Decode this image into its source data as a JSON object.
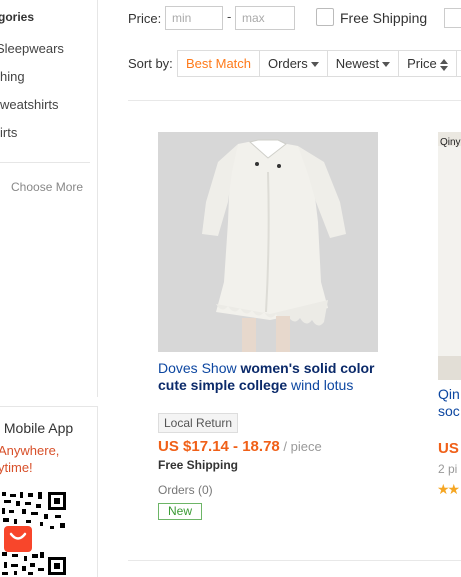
{
  "sidebar": {
    "categories_title": "gories",
    "items": [
      "Sleepwears",
      "hing",
      "weatshirts",
      "irts"
    ],
    "choose_more": "Choose More"
  },
  "app_promo": {
    "title": "s Mobile App",
    "line1": "Anywhere,",
    "line2": "ytime!",
    "badge_text": "AliExpress"
  },
  "filters": {
    "price_label": "Price:",
    "min_placeholder": "min",
    "max_placeholder": "max",
    "dash": "-",
    "free_shipping_label": "Free Shipping"
  },
  "sort": {
    "label": "Sort by:",
    "options": [
      "Best Match",
      "Orders",
      "Newest",
      "Price"
    ],
    "active_index": 0
  },
  "colors": {
    "accent_orange": "#ff7a1a",
    "price_orange": "#f06018",
    "link_blue": "#0d47a1",
    "new_green": "#3a9a34"
  },
  "products": [
    {
      "title_prefix": "Doves Show ",
      "title_bold": "women's solid color cute simple college",
      "title_suffix": " wind lotus",
      "badge": "Local Return",
      "price": "US $17.14 - 18.78",
      "unit": " / piece",
      "shipping": "Free Shipping",
      "orders": "Orders (0)",
      "tag": "New"
    },
    {
      "image_caption": "Qiny",
      "title_line1": "Qin",
      "title_line2": "soc",
      "price": "US",
      "pieces": "2 pi",
      "rating_icon": "star-icon"
    }
  ]
}
